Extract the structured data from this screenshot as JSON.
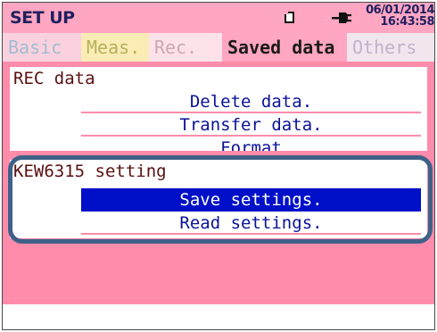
{
  "header": {
    "title": "SET UP",
    "date": "06/01/2014",
    "time": "16:43:58",
    "icons": [
      "memory-card-icon",
      "power-plug-icon"
    ]
  },
  "tabs": [
    {
      "label": "Basic",
      "active": false
    },
    {
      "label": "Meas.",
      "active": false
    },
    {
      "label": "Rec.",
      "active": false
    },
    {
      "label": "Saved data",
      "active": true
    },
    {
      "label": "Others",
      "active": false
    }
  ],
  "rec_section": {
    "title": "REC data",
    "items": [
      "Delete data.",
      "Transfer data.",
      "Format"
    ]
  },
  "kew_section": {
    "title": "KEW6315 setting",
    "items": [
      "Save settings.",
      "Read settings."
    ],
    "selected_item": "Save settings."
  },
  "colors": {
    "accent_pink": "#ff8caa",
    "selection_blue": "#0010c8",
    "item_text_blue": "#0a1299",
    "callout_frame": "#3f6188"
  }
}
